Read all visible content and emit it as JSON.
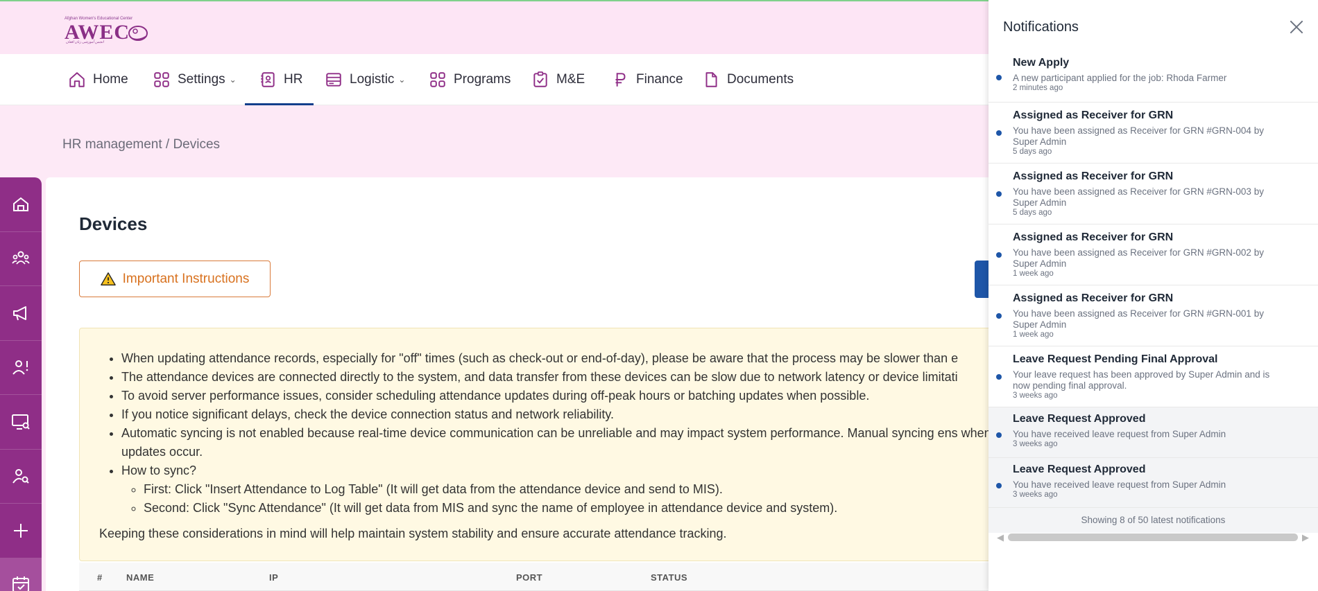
{
  "brand": {
    "tagline": "Afghan Women's Educational Center",
    "name": "AWEC",
    "script_line": "انجمن آموزشی زنان افغان"
  },
  "nav": {
    "home": "Home",
    "settings": "Settings",
    "hr": "HR",
    "logistic": "Logistic",
    "programs": "Programs",
    "me": "M&E",
    "finance": "Finance",
    "documents": "Documents",
    "active": "HR"
  },
  "breadcrumb": "HR management / Devices",
  "page": {
    "title": "Devices",
    "warning_button": "Important Instructions"
  },
  "instructions": {
    "items": [
      "When updating attendance records, especially for \"off\" times (such as check-out or end-of-day), please be aware that the process may be slower than e",
      "The attendance devices are connected directly to the system, and data transfer from these devices can be slow due to network latency or device limitati",
      "To avoid server performance issues, consider scheduling attendance updates during off-peak hours or batching updates when possible.",
      "If you notice significant delays, check the device connection status and network reliability.",
      "Automatic syncing is not enabled because real-time device communication can be unreliable and may impact system performance. Manual syncing ens when updates occur.",
      "How to sync?"
    ],
    "sub_items": [
      "First: Click \"Insert Attendance to Log Table\" (It will get data from the attendance device and send to MIS).",
      "Second: Click \"Sync Attendance\" (It will get data from MIS and sync the name of employee in attendance device and system)."
    ],
    "footer": "Keeping these considerations in mind will help maintain system stability and ensure accurate attendance tracking."
  },
  "table": {
    "columns": [
      "#",
      "NAME",
      "IP",
      "PORT",
      "STATUS"
    ]
  },
  "notifications": {
    "title": "Notifications",
    "items": [
      {
        "title": "New Apply",
        "body": "A new participant applied for the job: Rhoda Farmer",
        "time": "2 minutes ago",
        "read": false
      },
      {
        "title": "Assigned as Receiver for GRN",
        "body": "You have been assigned as Receiver for GRN #GRN-004 by Super Admin",
        "time": "5 days ago",
        "read": false
      },
      {
        "title": "Assigned as Receiver for GRN",
        "body": "You have been assigned as Receiver for GRN #GRN-003 by Super Admin",
        "time": "5 days ago",
        "read": false
      },
      {
        "title": "Assigned as Receiver for GRN",
        "body": "You have been assigned as Receiver for GRN #GRN-002 by Super Admin",
        "time": "1 week ago",
        "read": false
      },
      {
        "title": "Assigned as Receiver for GRN",
        "body": "You have been assigned as Receiver for GRN #GRN-001 by Super Admin",
        "time": "1 week ago",
        "read": false
      },
      {
        "title": "Leave Request Pending Final Approval",
        "body": "Your leave request has been approved by Super Admin and is now pending final approval.",
        "time": "3 weeks ago",
        "read": false
      },
      {
        "title": "Leave Request Approved",
        "body": "You have received leave request from Super Admin",
        "time": "3 weeks ago",
        "read": true
      },
      {
        "title": "Leave Request Approved",
        "body": "You have received leave request from Super Admin",
        "time": "3 weeks ago",
        "read": true
      }
    ],
    "footer": "Showing 8 of 50 latest notifications"
  },
  "colors": {
    "brand_purple": "#8f2e87",
    "header_pink": "#fde5f5",
    "accent_blue": "#1e56a8",
    "warning_orange": "#d8711e"
  }
}
